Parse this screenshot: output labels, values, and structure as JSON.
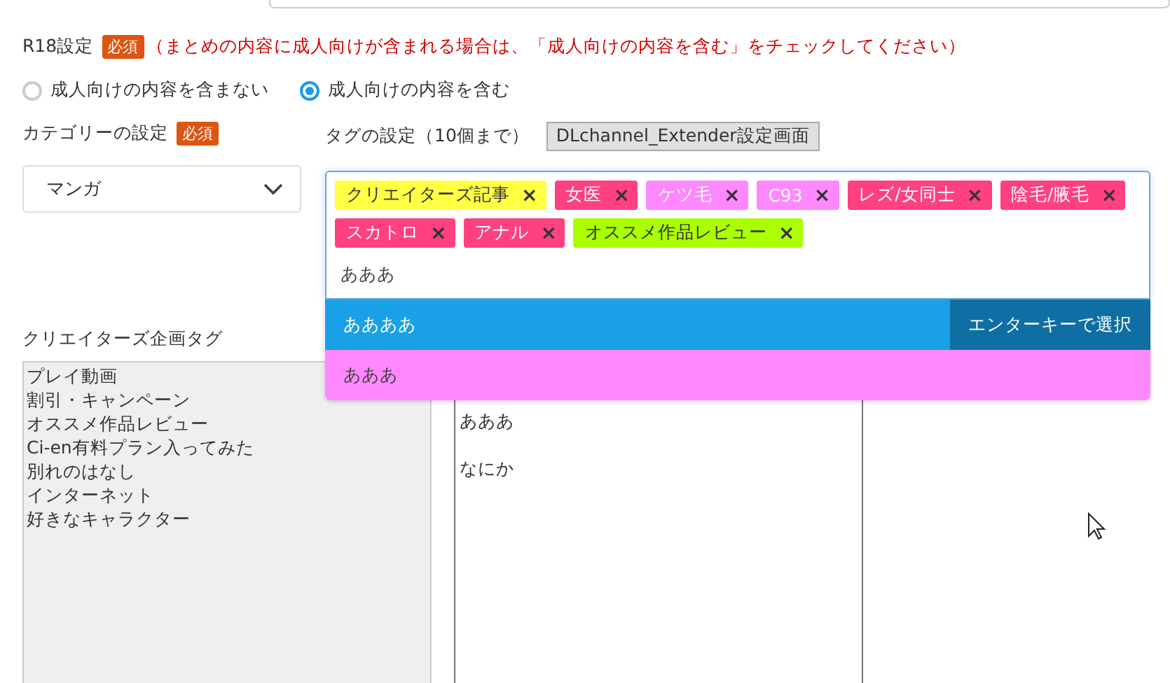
{
  "r18": {
    "label": "R18設定",
    "badge": "必須",
    "note": "（まとめの内容に成人向けが含まれる場合は、「成人向けの内容を含む」をチェックしてください）",
    "options": [
      {
        "label": "成人向けの内容を含まない",
        "selected": false
      },
      {
        "label": "成人向けの内容を含む",
        "selected": true
      }
    ]
  },
  "category": {
    "label": "カテゴリーの設定",
    "badge": "必須",
    "value": "マンガ"
  },
  "tags": {
    "label": "タグの設定（10個まで）",
    "button": "DLchannel_Extender設定画面",
    "items": [
      {
        "label": "クリエイターズ記事",
        "color": "#ffff44"
      },
      {
        "label": "女医",
        "color": "#ff4081"
      },
      {
        "label": "ケツ毛",
        "color": "#ff88ff"
      },
      {
        "label": "C93",
        "color": "#ff88ff"
      },
      {
        "label": "レズ/女同士",
        "color": "#ff4081"
      },
      {
        "label": "陰毛/腋毛",
        "color": "#ff4081"
      },
      {
        "label": "スカトロ",
        "color": "#ff4081"
      },
      {
        "label": "アナル",
        "color": "#ff4081"
      },
      {
        "label": "オススメ作品レビュー",
        "color": "#aaff00"
      }
    ],
    "remove_symbol": "×",
    "input": "あああ",
    "suggestions": [
      {
        "label": "ああああ",
        "selected": true,
        "hint": "エンターキーで選択",
        "color": "#19a0e6"
      },
      {
        "label": "あああ",
        "selected": false,
        "color": "#ff88ff"
      }
    ]
  },
  "creators_tags": {
    "label": "クリエイターズ企画タグ",
    "items": [
      "プレイ動画",
      "割引・キャンペーン",
      "オススメ作品レビュー",
      "Ci-en有料プラン入ってみた",
      "別れのはなし",
      "インターネット",
      "好きなキャラクター"
    ]
  },
  "text_area": {
    "lines": [
      "あああ",
      "なにか"
    ]
  }
}
